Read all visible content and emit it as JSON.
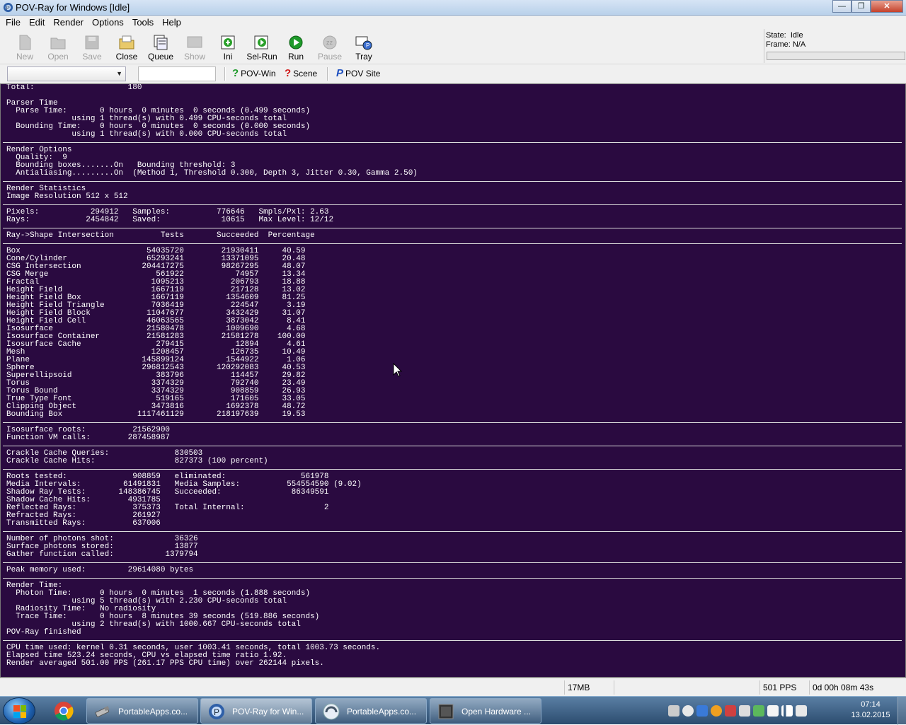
{
  "window": {
    "title": "POV-Ray for Windows [Idle]"
  },
  "menu": [
    "File",
    "Edit",
    "Render",
    "Options",
    "Tools",
    "Help"
  ],
  "toolbar": {
    "new": "New",
    "open": "Open",
    "save": "Save",
    "close": "Close",
    "queue": "Queue",
    "show": "Show",
    "ini": "Ini",
    "selrun": "Sel-Run",
    "run": "Run",
    "pause": "Pause",
    "tray": "Tray"
  },
  "status": {
    "state_label": "State:",
    "state": "Idle",
    "frame_label": "Frame:",
    "frame": "N/A"
  },
  "toolbar2": {
    "combo_value": "",
    "text_value": "",
    "povwin": "POV-Win",
    "scene": "Scene",
    "povsite": "POV Site"
  },
  "messages": [
    "Total:                    180",
    "",
    "Parser Time",
    "  Parse Time:       0 hours  0 minutes  0 seconds (0.499 seconds)",
    "              using 1 thread(s) with 0.499 CPU-seconds total",
    "  Bounding Time:    0 hours  0 minutes  0 seconds (0.000 seconds)",
    "              using 1 thread(s) with 0.000 CPU-seconds total",
    "---",
    "Render Options",
    "  Quality:  9",
    "  Bounding boxes.......On   Bounding threshold: 3",
    "  Antialiasing.........On  (Method 1, Threshold 0.300, Depth 3, Jitter 0.30, Gamma 2.50)",
    "---",
    "Render Statistics",
    "Image Resolution 512 x 512",
    "---",
    "Pixels:           294912   Samples:          776646   Smpls/Pxl: 2.63",
    "Rays:            2454842   Saved:             10615   Max Level: 12/12",
    "---",
    "Ray->Shape Intersection          Tests       Succeeded  Percentage",
    "---",
    "Box                           54035720        21930411     40.59",
    "Cone/Cylinder                 65293241        13371095     20.48",
    "CSG Intersection             204417275        98267295     48.07",
    "CSG Merge                       561922           74957     13.34",
    "Fractal                        1095213          206793     18.88",
    "Height Field                   1667119          217128     13.02",
    "Height Field Box               1667119         1354609     81.25",
    "Height Field Triangle          7036419          224547      3.19",
    "Height Field Block            11047677         3432429     31.07",
    "Height Field Cell             46063565         3873042      8.41",
    "Isosurface                    21580478         1009690      4.68",
    "Isosurface Container          21581283        21581278    100.00",
    "Isosurface Cache                279415           12894      4.61",
    "Mesh                           1208457          126735     10.49",
    "Plane                        145899124         1544922      1.06",
    "Sphere                       296812543       120292083     40.53",
    "Superellipsoid                  383796          114457     29.82",
    "Torus                          3374329          792740     23.49",
    "Torus Bound                    3374329          908859     26.93",
    "True Type Font                  519165          171605     33.05",
    "Clipping Object                3473816         1692378     48.72",
    "Bounding Box                1117461129       218197639     19.53",
    "---",
    "Isosurface roots:          21562900",
    "Function VM calls:        287458987",
    "---",
    "Crackle Cache Queries:              830503",
    "Crackle Cache Hits:                 827373 (100 percent)",
    "---",
    "Roots tested:              908859   eliminated:                561978",
    "Media Intervals:         61491831   Media Samples:          554554590 (9.02)",
    "Shadow Ray Tests:       148386745   Succeeded:               86349591",
    "Shadow Cache Hits:        4931785",
    "Reflected Rays:            375373   Total Internal:                 2",
    "Refracted Rays:            261927",
    "Transmitted Rays:          637006",
    "---",
    "Number of photons shot:             36326",
    "Surface photons stored:             13877",
    "Gather function called:           1379794",
    "---",
    "Peak memory used:         29614080 bytes",
    "---",
    "Render Time:",
    "  Photon Time:      0 hours  0 minutes  1 seconds (1.888 seconds)",
    "              using 5 thread(s) with 2.230 CPU-seconds total",
    "  Radiosity Time:   No radiosity",
    "  Trace Time:       0 hours  8 minutes 39 seconds (519.886 seconds)",
    "              using 2 thread(s) with 1000.667 CPU-seconds total",
    "POV-Ray finished",
    "---",
    "CPU time used: kernel 0.31 seconds, user 1003.41 seconds, total 1003.73 seconds.",
    "Elapsed time 523.24 seconds, CPU vs elapsed time ratio 1.92.",
    "Render averaged 501.00 PPS (261.17 PPS CPU time) over 262144 pixels."
  ],
  "statusbar": {
    "memory": "17MB",
    "pps": "501 PPS",
    "elapsed": "0d 00h 08m 43s"
  },
  "taskbar": {
    "tasks": [
      "PortableApps.co...",
      "POV-Ray for Win...",
      "PortableApps.co...",
      "Open Hardware ..."
    ],
    "time": "07:14",
    "date": "13.02.2015"
  },
  "colors": {
    "console_bg": "#2a0a40",
    "console_text": "#ffffff",
    "taskbar": "#3b6189"
  }
}
